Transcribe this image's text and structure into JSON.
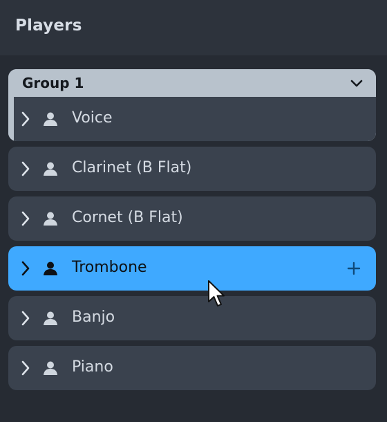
{
  "panel": {
    "title": "Players"
  },
  "group": {
    "name": "Group 1",
    "icon": "chevron-down-icon"
  },
  "players": [
    {
      "name": "Voice",
      "selected": false
    },
    {
      "name": "Clarinet (B Flat)",
      "selected": false
    },
    {
      "name": "Cornet (B Flat)",
      "selected": false
    },
    {
      "name": "Trombone",
      "selected": true
    },
    {
      "name": "Banjo",
      "selected": false
    },
    {
      "name": "Piano",
      "selected": false
    }
  ],
  "icons": {
    "expand": "chevron-right-icon",
    "player": "person-icon",
    "add": "plus-icon",
    "cursor": "mouse-pointer-icon"
  },
  "colors": {
    "background": "#262b33",
    "header": "#2d333c",
    "row": "#3a424e",
    "selected": "#3fa9ff",
    "group_header": "#b8c2cc",
    "text": "#d5dbe3"
  }
}
